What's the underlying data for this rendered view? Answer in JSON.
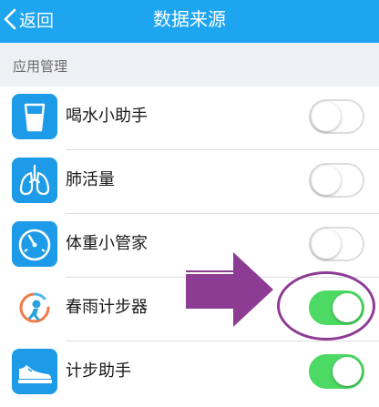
{
  "nav": {
    "back_label": "返回",
    "title": "数据来源",
    "bar_color": "#1ea5ef"
  },
  "section": {
    "header": "应用管理"
  },
  "apps": [
    {
      "name": "喝水小助手",
      "icon": "water-glass-icon",
      "enabled": false
    },
    {
      "name": "肺活量",
      "icon": "lungs-icon",
      "enabled": false
    },
    {
      "name": "体重小管家",
      "icon": "scale-gauge-icon",
      "enabled": false
    },
    {
      "name": "春雨计步器",
      "icon": "chunyu-pedometer-icon",
      "enabled": true
    },
    {
      "name": "计步助手",
      "icon": "sneaker-icon",
      "enabled": true
    }
  ],
  "colors": {
    "toggle_on": "#4cd964",
    "annotation": "#8d3c93"
  }
}
